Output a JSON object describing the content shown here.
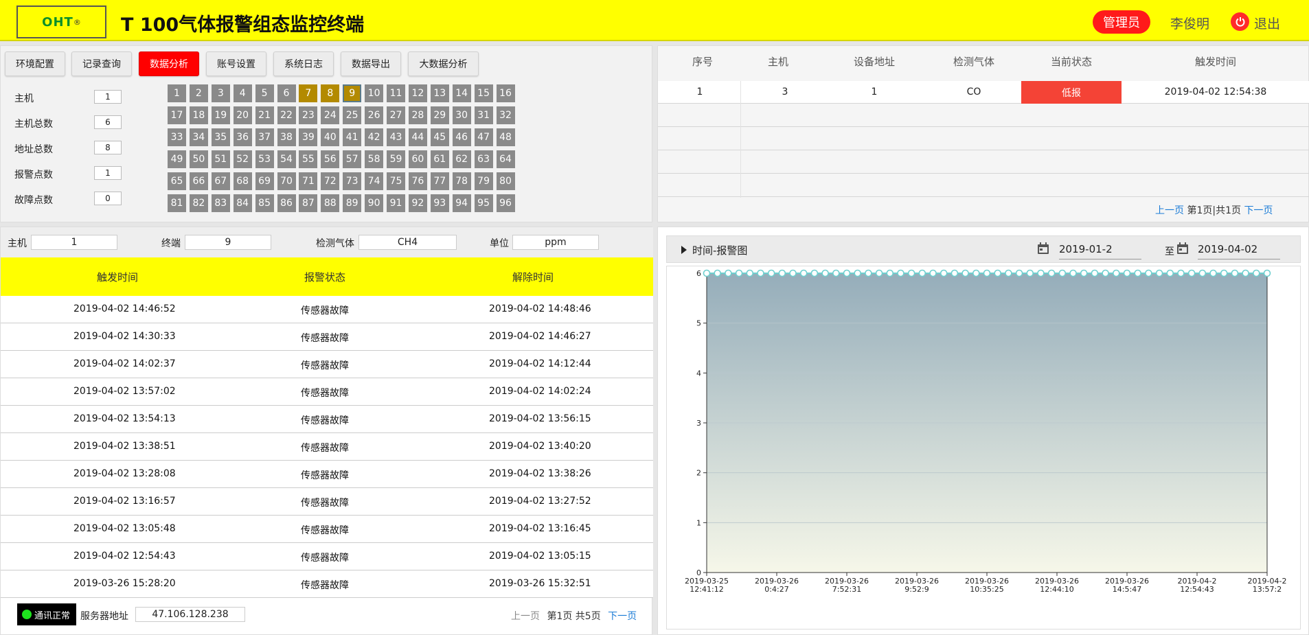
{
  "header": {
    "logo_text": "OHT",
    "logo_mark": "®",
    "title": "T 100气体报警组态监控终端",
    "role": "管理员",
    "user": "李俊明",
    "logout": "退出"
  },
  "nav": {
    "buttons": [
      "环境配置",
      "记录查询",
      "数据分析",
      "账号设置",
      "系统日志",
      "数据导出",
      "大数据分析"
    ],
    "active": "数据分析"
  },
  "stats": [
    {
      "label": "主机",
      "value": "1"
    },
    {
      "label": "主机总数",
      "value": "6"
    },
    {
      "label": "地址总数",
      "value": "8"
    },
    {
      "label": "报警点数",
      "value": "1"
    },
    {
      "label": "故障点数",
      "value": "0"
    }
  ],
  "address_grid": {
    "count": 96,
    "highlighted": [
      7,
      8,
      9
    ],
    "selected": 9
  },
  "alarm_table": {
    "headers": [
      "序号",
      "主机",
      "设备地址",
      "检测气体",
      "当前状态",
      "触发时间"
    ],
    "rows": [
      {
        "no": "1",
        "host": "3",
        "addr": "1",
        "gas": "CO",
        "status": "低报",
        "time": "2019-04-02 12:54:38"
      }
    ],
    "pager": {
      "prev": "上一页",
      "info": "第1页|共1页",
      "next": "下一页"
    }
  },
  "filter": {
    "host_label": "主机",
    "host_value": "1",
    "terminal_label": "终端",
    "terminal_value": "9",
    "gas_label": "检测气体",
    "gas_value": "CH4",
    "unit_label": "单位",
    "unit_value": "ppm"
  },
  "log_table": {
    "headers": [
      "触发时间",
      "报警状态",
      "解除时间"
    ],
    "rows": [
      {
        "trigger": "2019-04-02 14:46:52",
        "state": "传感器故障",
        "clear": "2019-04-02 14:48:46"
      },
      {
        "trigger": "2019-04-02 14:30:33",
        "state": "传感器故障",
        "clear": "2019-04-02 14:46:27"
      },
      {
        "trigger": "2019-04-02 14:02:37",
        "state": "传感器故障",
        "clear": "2019-04-02 14:12:44"
      },
      {
        "trigger": "2019-04-02 13:57:02",
        "state": "传感器故障",
        "clear": "2019-04-02 14:02:24"
      },
      {
        "trigger": "2019-04-02 13:54:13",
        "state": "传感器故障",
        "clear": "2019-04-02 13:56:15"
      },
      {
        "trigger": "2019-04-02 13:38:51",
        "state": "传感器故障",
        "clear": "2019-04-02 13:40:20"
      },
      {
        "trigger": "2019-04-02 13:28:08",
        "state": "传感器故障",
        "clear": "2019-04-02 13:38:26"
      },
      {
        "trigger": "2019-04-02 13:16:57",
        "state": "传感器故障",
        "clear": "2019-04-02 13:27:52"
      },
      {
        "trigger": "2019-04-02 13:05:48",
        "state": "传感器故障",
        "clear": "2019-04-02 13:16:45"
      },
      {
        "trigger": "2019-04-02 12:54:43",
        "state": "传感器故障",
        "clear": "2019-04-02 13:05:15"
      },
      {
        "trigger": "2019-03-26 15:28:20",
        "state": "传感器故障",
        "clear": "2019-03-26 15:32:51"
      }
    ],
    "pager": {
      "prev": "上一页",
      "info": "第1页 共5页",
      "next": "下一页"
    }
  },
  "footer": {
    "comm_status": "通讯正常",
    "server_label": "服务器地址",
    "server_value": "47.106.128.238"
  },
  "chart_panel": {
    "title": "时间-报警图",
    "date_from": "2019-01-2",
    "to_label": "至",
    "date_to": "2019-04-02"
  },
  "chart_data": {
    "type": "area",
    "title": "",
    "ylim": [
      0,
      6
    ],
    "yticks": [
      0,
      1,
      2,
      3,
      4,
      5,
      6
    ],
    "xtick_labels": [
      [
        "2019-03-25",
        "12:41:12"
      ],
      [
        "2019-03-26",
        "0:4:27"
      ],
      [
        "2019-03-26",
        "7:52:31"
      ],
      [
        "2019-03-26",
        "9:52:9"
      ],
      [
        "2019-03-26",
        "10:35:25"
      ],
      [
        "2019-03-26",
        "12:44:10"
      ],
      [
        "2019-03-26",
        "14:5:47"
      ],
      [
        "2019-04-2",
        "12:54:43"
      ],
      [
        "2019-04-2",
        "13:57:2"
      ]
    ],
    "point_count": 53,
    "point_value": 6,
    "colors": {
      "fill_top": "#95adba",
      "fill_bottom": "#f6f7e9",
      "line": "#6fcfcf",
      "marker_fill": "#ffffff"
    }
  }
}
